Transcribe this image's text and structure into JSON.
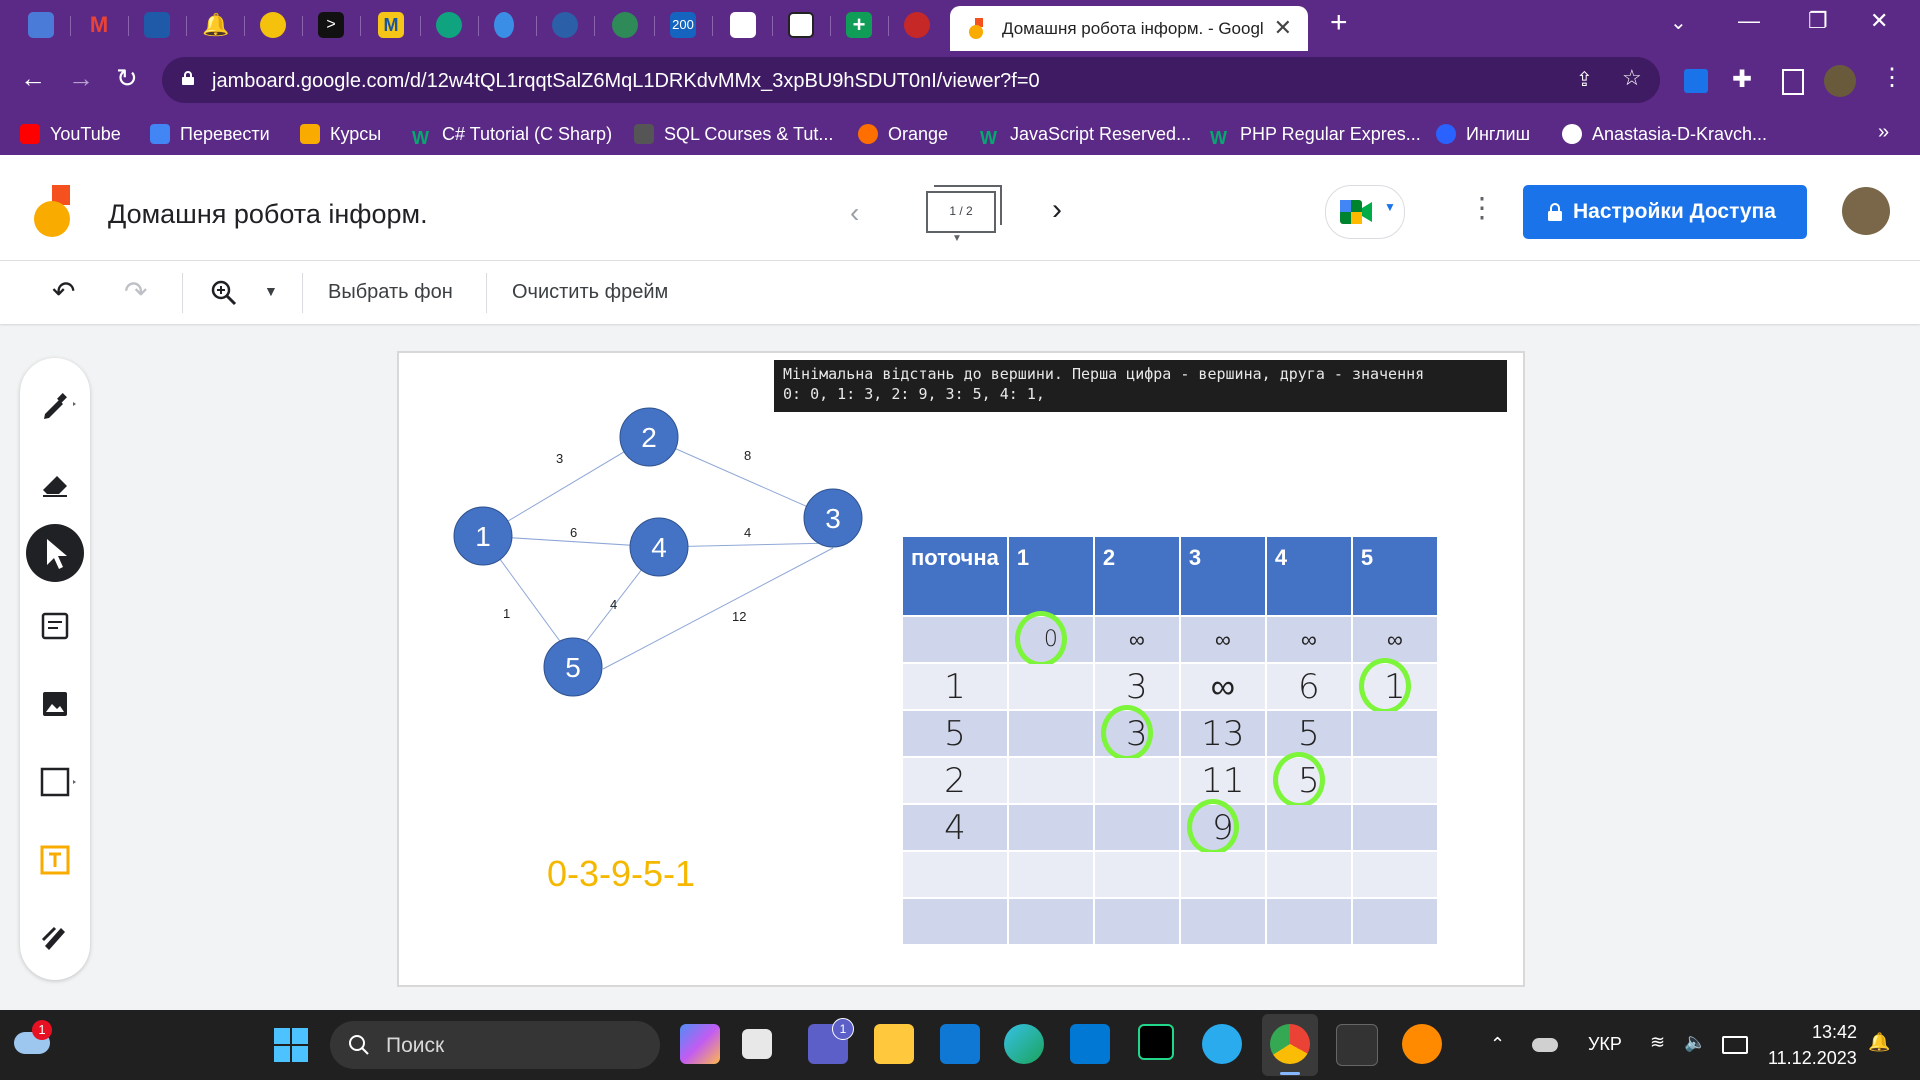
{
  "browser": {
    "active_tab_title": "Домашня робота інформ. - Google Jamboard",
    "url": "jamboard.google.com/d/12w4tQL1rqqtSalZ6MqL1DRKdvMMx_3xpBU9hSDUT0nI/viewer?f=0",
    "tab_badge": "200",
    "bookmarks": [
      "YouTube",
      "Перевести",
      "Курсы",
      "C# Tutorial (C Sharp)",
      "SQL Courses & Tut...",
      "Orange",
      "JavaScript Reserved...",
      "PHP Regular Expres...",
      "Инглиш",
      "Anastasia-D-Kravch..."
    ],
    "bookmarks_more": "»"
  },
  "jamboard": {
    "title": "Домашня робота інформ.",
    "frame_indicator": "1 / 2",
    "share_label": "Настройки Доступа",
    "toolbar": {
      "set_background": "Выбрать фон",
      "clear_frame": "Очистить фрейм"
    }
  },
  "frame": {
    "console_lines": [
      "Мінімальна відстань до вершини. Перша цифра - вершина, друга - значення",
      "0: 0, 1: 3, 2: 9, 3: 5, 4: 1,"
    ],
    "answer": "0-3-9-5-1",
    "graph": {
      "nodes": [
        "1",
        "2",
        "3",
        "4",
        "5"
      ],
      "edges": [
        {
          "from": "1",
          "to": "2",
          "weight": "3"
        },
        {
          "from": "2",
          "to": "3",
          "weight": "8"
        },
        {
          "from": "1",
          "to": "4",
          "weight": "6"
        },
        {
          "from": "4",
          "to": "3",
          "weight": "4"
        },
        {
          "from": "1",
          "to": "5",
          "weight": "1"
        },
        {
          "from": "5",
          "to": "4",
          "weight": "4"
        },
        {
          "from": "5",
          "to": "3",
          "weight": "12"
        }
      ]
    },
    "table": {
      "header": [
        "поточна",
        "1",
        "2",
        "3",
        "4",
        "5"
      ],
      "rows": [
        [
          "",
          "0",
          "∞",
          "∞",
          "∞",
          "∞"
        ],
        [
          "1",
          "",
          "3",
          "∞",
          "6",
          "1"
        ],
        [
          "5",
          "",
          "3",
          "13",
          "5",
          ""
        ],
        [
          "2",
          "",
          "",
          "11",
          "5",
          ""
        ],
        [
          "4",
          "",
          "",
          "9",
          "",
          ""
        ],
        [
          "",
          "",
          "",
          "",
          "",
          ""
        ],
        [
          "",
          "",
          "",
          "",
          "",
          ""
        ]
      ],
      "circled_cells": [
        [
          0,
          1
        ],
        [
          1,
          5
        ],
        [
          2,
          2
        ],
        [
          3,
          4
        ],
        [
          4,
          3
        ]
      ]
    },
    "colors": {
      "node": "#4472c4",
      "header": "#4472c4",
      "row_light": "#cfd5ea",
      "row_lighter": "#e9ebf5",
      "highlight": "#7cf53a",
      "answer": "#f5b800"
    }
  },
  "taskbar": {
    "search_placeholder": "Поиск",
    "weather_badge": "1",
    "teams_badge": "1",
    "language": "УКР",
    "time": "13:42",
    "date": "11.12.2023"
  }
}
